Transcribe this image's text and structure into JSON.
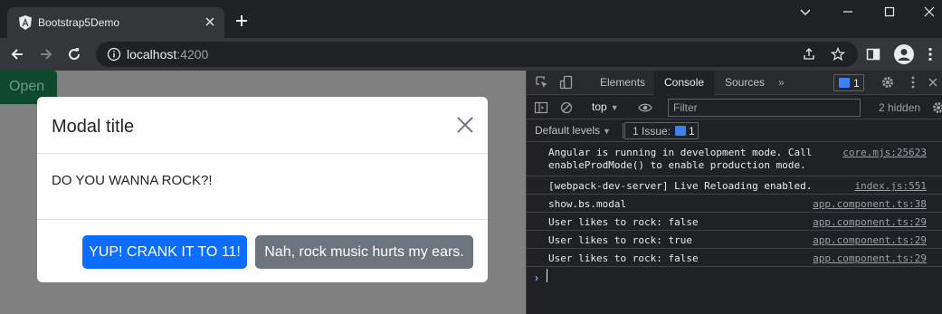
{
  "browser": {
    "tab_title": "Bootstrap5Demo",
    "url_host": "localhost",
    "url_port": ":4200"
  },
  "page": {
    "open_button": "Open",
    "modal": {
      "title": "Modal title",
      "body": "DO YOU WANNA ROCK?!",
      "primary_button": "YUP! CRANK IT TO 11!",
      "secondary_button": "Nah, rock music hurts my ears."
    }
  },
  "devtools": {
    "tabs": [
      "Elements",
      "Console",
      "Sources"
    ],
    "active_tab": "Console",
    "more_tabs": "»",
    "message_badge_count": "1",
    "context": "top",
    "filter_placeholder": "Filter",
    "hidden_count": "2 hidden",
    "levels": "Default levels",
    "issues_label": "1 Issue:",
    "issues_count": "1",
    "messages": [
      {
        "text": "Angular is running in development mode. Call\nenableProdMode() to enable production mode.",
        "source": "core.mjs:25623"
      },
      {
        "text": "[webpack-dev-server] Live Reloading enabled.",
        "source": "index.js:551"
      },
      {
        "text": "show.bs.modal",
        "source": "app.component.ts:38"
      },
      {
        "text": "User likes to rock: false",
        "source": "app.component.ts:29"
      },
      {
        "text": "User likes to rock: true",
        "source": "app.component.ts:29"
      },
      {
        "text": "User likes to rock: false",
        "source": "app.component.ts:29"
      }
    ],
    "prompt": "›"
  }
}
